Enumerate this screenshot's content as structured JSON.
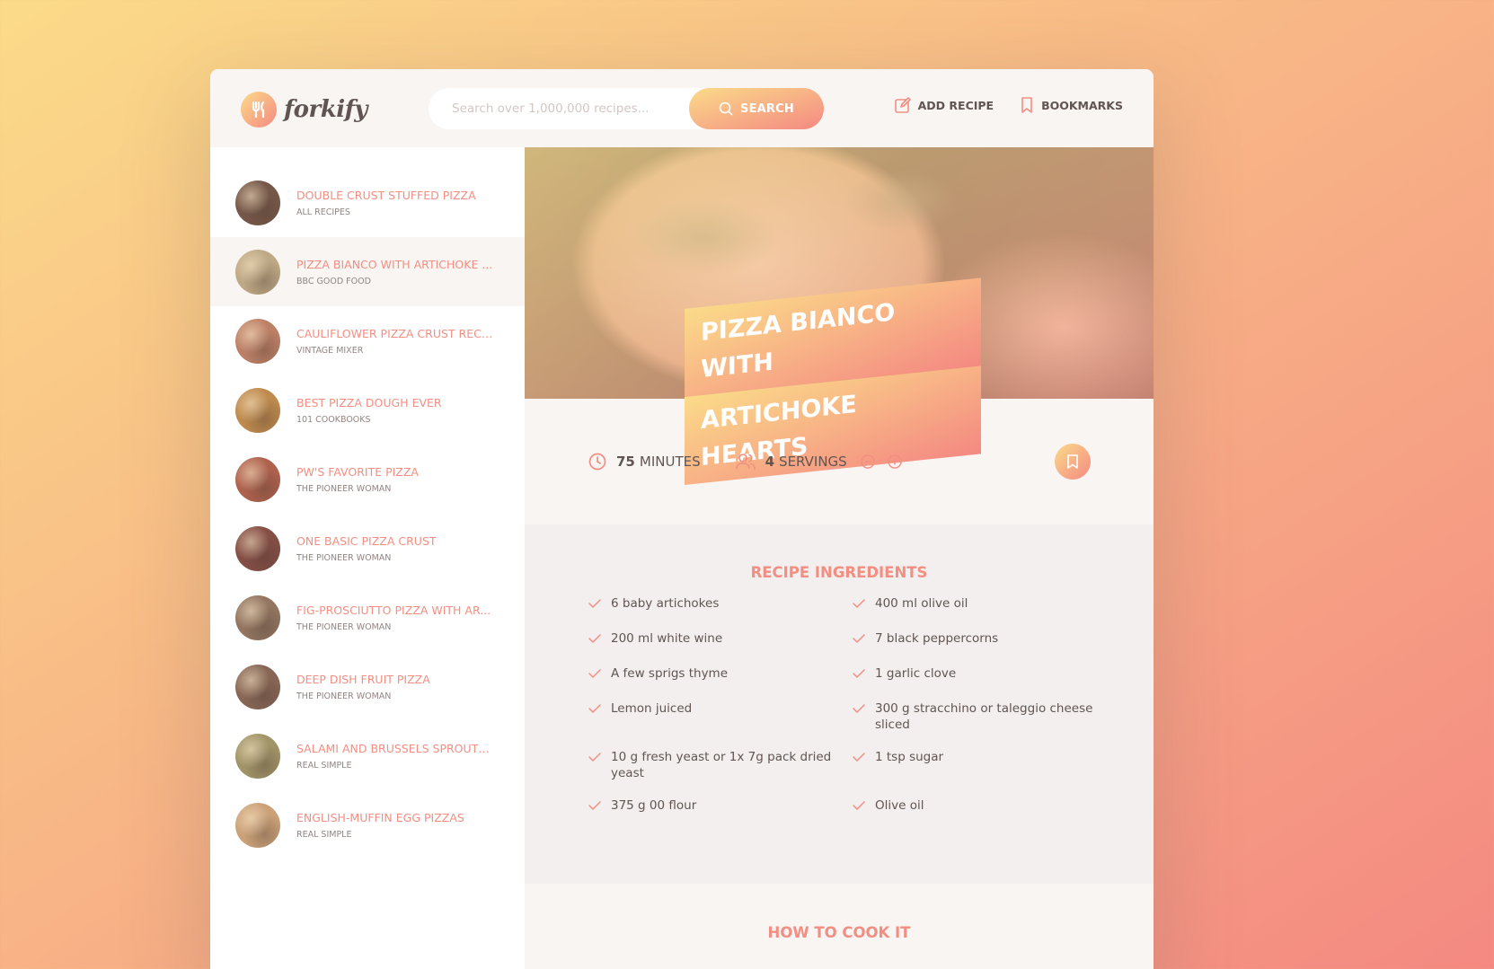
{
  "header": {
    "logo_text": "forkify",
    "search_placeholder": "Search over 1,000,000 recipes...",
    "search_button": "SEARCH",
    "nav": {
      "add_recipe": "ADD RECIPE",
      "bookmarks": "BOOKMARKS"
    }
  },
  "results": [
    {
      "title": "DOUBLE CRUST STUFFED PIZZA",
      "publisher": "ALL RECIPES",
      "color": "#6b4a3a"
    },
    {
      "title": "PIZZA BIANCO WITH ARTICHOKE ...",
      "publisher": "BBC GOOD FOOD",
      "color": "#b9a27c"
    },
    {
      "title": "CAULIFLOWER PIZZA CRUST RECI...",
      "publisher": "VINTAGE MIXER",
      "color": "#b8765a"
    },
    {
      "title": "BEST PIZZA DOUGH EVER",
      "publisher": "101 COOKBOOKS",
      "color": "#b9813f"
    },
    {
      "title": "PW'S FAVORITE PIZZA",
      "publisher": "THE PIONEER WOMAN",
      "color": "#a8553e"
    },
    {
      "title": "ONE BASIC PIZZA CRUST",
      "publisher": "THE PIONEER WOMAN",
      "color": "#7a3f36"
    },
    {
      "title": "FIG-PROSCIUTTO PIZZA WITH AR...",
      "publisher": "THE PIONEER WOMAN",
      "color": "#8a6a54"
    },
    {
      "title": "DEEP DISH FRUIT PIZZA",
      "publisher": "THE PIONEER WOMAN",
      "color": "#7e5a48"
    },
    {
      "title": "SALAMI AND BRUSSELS SPROUTS...",
      "publisher": "REAL SIMPLE",
      "color": "#9a8c5c"
    },
    {
      "title": "ENGLISH-MUFFIN EGG PIZZAS",
      "publisher": "REAL SIMPLE",
      "color": "#c79a6e"
    }
  ],
  "recipe": {
    "title_line1": "PIZZA BIANCO WITH",
    "title_line2": "ARTICHOKE HEARTS",
    "minutes_value": "75",
    "minutes_label": "MINUTES",
    "servings_value": "4",
    "servings_label": "SERVINGS",
    "ingredients_heading": "RECIPE INGREDIENTS",
    "ingredients": [
      "6 baby artichokes",
      "400 ml olive oil",
      "200 ml white wine",
      "7 black peppercorns",
      "A few sprigs thyme",
      "1 garlic clove",
      "Lemon juiced",
      "300 g stracchino or taleggio cheese sliced",
      "10 g fresh yeast or 1x 7g pack dried yeast",
      "1 tsp sugar",
      "375 g 00 flour",
      "Olive oil"
    ],
    "cook_heading": "HOW TO COOK IT"
  },
  "colors": {
    "accent": "#f38e82",
    "text": "#615551",
    "gradient_start": "#fbdb89",
    "gradient_end": "#f48982"
  }
}
